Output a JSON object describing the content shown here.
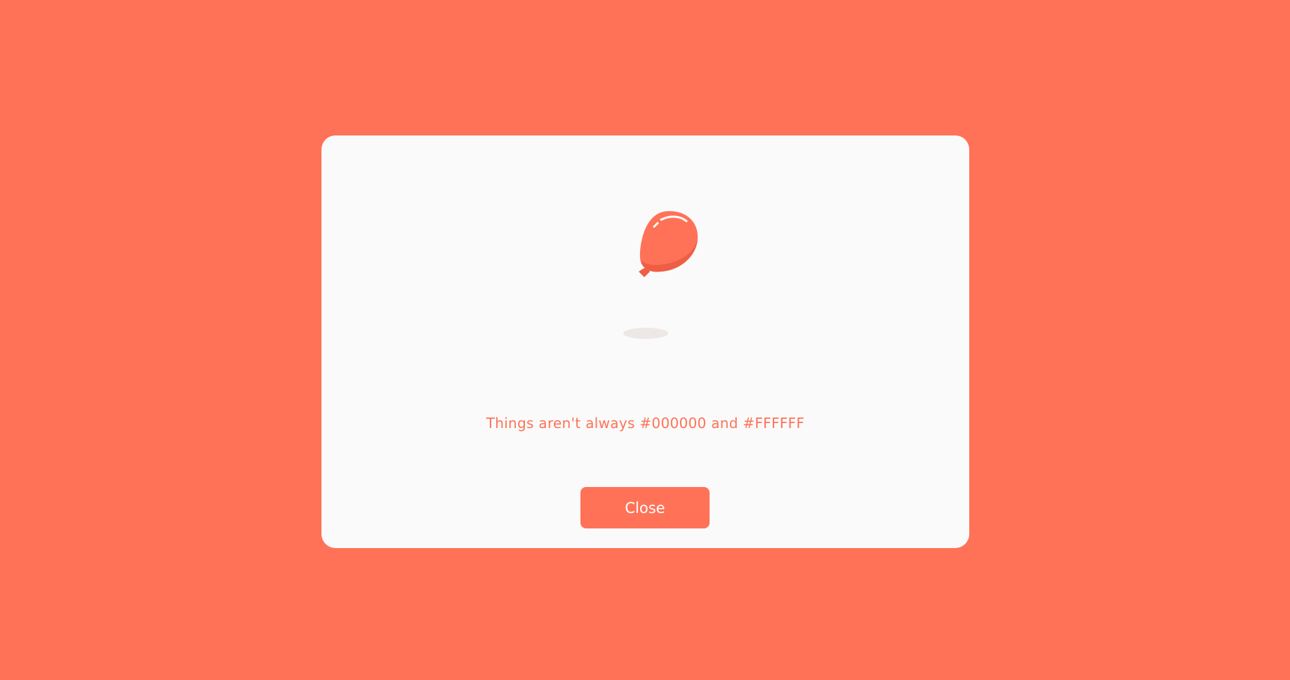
{
  "modal": {
    "message": "Things aren't always #000000 and #FFFFFF",
    "close_label": "Close",
    "illustration": "balloon-icon"
  },
  "colors": {
    "background": "#FF7257",
    "modal_background": "#FAFAFA",
    "accent": "#FF7257",
    "button_text": "#FFFFFF"
  }
}
